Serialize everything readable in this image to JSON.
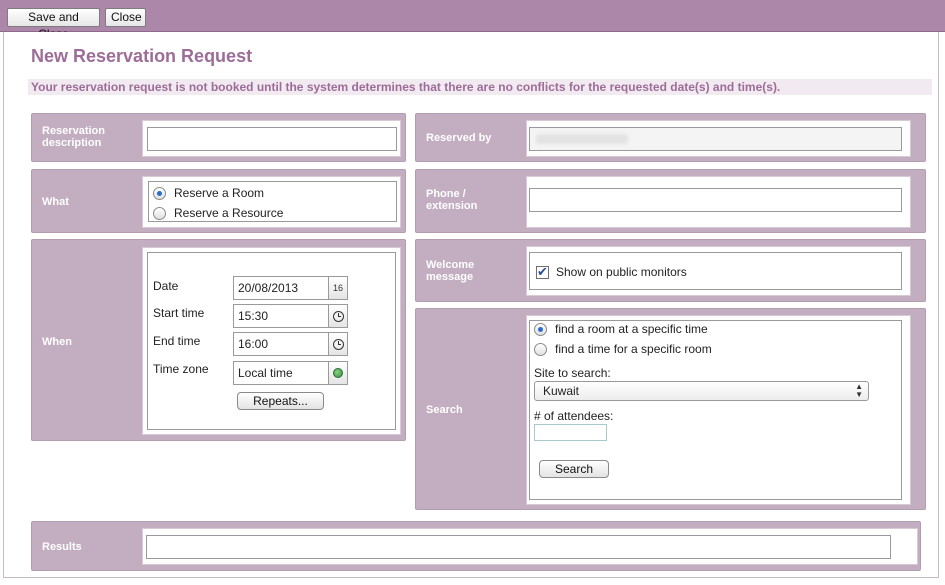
{
  "toolbar": {
    "save_close": "Save and Close",
    "close": "Close"
  },
  "page": {
    "title": "New Reservation Request",
    "notice": "Your reservation request is not booked until the system determines that there are no conflicts for the requested date(s) and time(s)."
  },
  "reservation_description": {
    "label": "Reservation description",
    "value": ""
  },
  "reserved_by": {
    "label": "Reserved by",
    "value": ""
  },
  "what": {
    "label": "What",
    "options": [
      {
        "label": "Reserve a Room",
        "selected": true
      },
      {
        "label": "Reserve a Resource",
        "selected": false
      }
    ]
  },
  "phone": {
    "label": "Phone / extension",
    "value": ""
  },
  "when": {
    "label": "When",
    "date_label": "Date",
    "date_value": "20/08/2013",
    "calendar_icon_text": "16",
    "start_label": "Start time",
    "start_value": "15:30",
    "end_label": "End time",
    "end_value": "16:00",
    "tz_label": "Time zone",
    "tz_value": "Local time",
    "repeats": "Repeats..."
  },
  "welcome": {
    "label": "Welcome message",
    "checkbox_label": "Show on public monitors",
    "checked": true
  },
  "search": {
    "label": "Search",
    "options": [
      {
        "label": "find a room at a specific time",
        "selected": true
      },
      {
        "label": "find a time for a specific room",
        "selected": false
      }
    ],
    "site_label": "Site to search:",
    "site_value": "Kuwait",
    "attendees_label": "# of attendees:",
    "attendees_value": "",
    "button": "Search"
  },
  "results": {
    "label": "Results"
  },
  "colors": {
    "toolbar": "#ad87aa",
    "panel": "#c3adc0",
    "title": "#9d6c98",
    "radio_selected": "#2a6bd1"
  },
  "icons": {
    "calendar": "calendar-icon",
    "clock": "clock-icon",
    "globe": "globe-icon",
    "select": "up-down-arrows-icon"
  }
}
